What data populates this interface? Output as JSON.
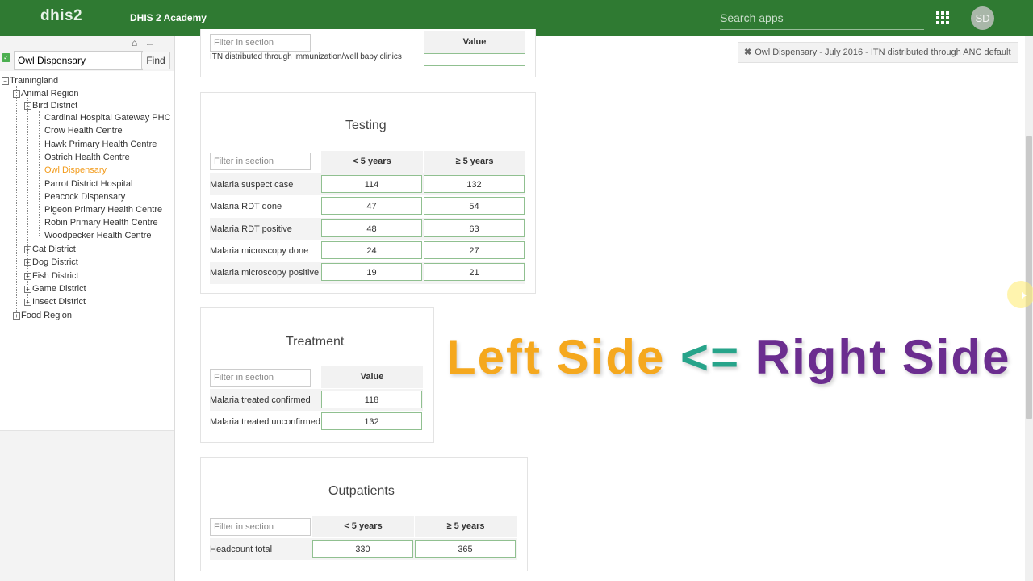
{
  "header": {
    "logo": "dhis2",
    "app_title": "DHIS 2 Academy",
    "search_placeholder": "Search apps",
    "avatar_initials": "SD"
  },
  "orgunit_panel": {
    "find_value": "Owl Dispensary",
    "find_label": "Find",
    "tree": {
      "root": "Trainingland",
      "region": "Animal Region",
      "district": "Bird District",
      "facilities": [
        "Cardinal Hospital Gateway PHC",
        "Crow Health Centre",
        "Hawk Primary Health Centre",
        "Ostrich Health Centre",
        "Owl Dispensary",
        "Parrot District Hospital",
        "Peacock Dispensary",
        "Pigeon Primary Health Centre",
        "Robin Primary Health Centre",
        "Woodpecker Health Centre"
      ],
      "selected": "Owl Dispensary",
      "other_districts": [
        "Cat District",
        "Dog District",
        "Fish District",
        "Game District",
        "Insect District"
      ],
      "other_region": "Food Region"
    }
  },
  "top_partial_section": {
    "filter_placeholder": "Filter in section",
    "value_header": "Value",
    "row_label": "ITN distributed through immunization/well baby clinics"
  },
  "history_tag": {
    "text": "Owl Dispensary - July 2016 - ITN distributed through ANC default"
  },
  "testing": {
    "title": "Testing",
    "filter_placeholder": "Filter in section",
    "columns": [
      "< 5 years",
      "≥ 5 years"
    ],
    "rows": [
      {
        "label": "Malaria suspect case",
        "values": [
          "114",
          "132"
        ]
      },
      {
        "label": "Malaria RDT done",
        "values": [
          "47",
          "54"
        ]
      },
      {
        "label": "Malaria RDT positive",
        "values": [
          "48",
          "63"
        ]
      },
      {
        "label": "Malaria microscopy done",
        "values": [
          "24",
          "27"
        ]
      },
      {
        "label": "Malaria microscopy positive",
        "values": [
          "19",
          "21"
        ]
      }
    ]
  },
  "treatment": {
    "title": "Treatment",
    "filter_placeholder": "Filter in section",
    "columns": [
      "Value"
    ],
    "rows": [
      {
        "label": "Malaria treated confirmed",
        "values": [
          "118"
        ]
      },
      {
        "label": "Malaria treated unconfirmed",
        "values": [
          "132"
        ]
      }
    ]
  },
  "outpatients": {
    "title": "Outpatients",
    "filter_placeholder": "Filter in section",
    "columns": [
      "< 5 years",
      "≥ 5 years"
    ],
    "rows": [
      {
        "label": "Headcount total",
        "values": [
          "330",
          "365"
        ]
      }
    ]
  },
  "overlay": {
    "left": "Left Side",
    "op": "<=",
    "right": "Right Side"
  },
  "colors": {
    "header_green": "#2f7a32",
    "selected_orange": "#f29b1b",
    "overlay_orange": "#f5a81e",
    "overlay_teal": "#27a48a",
    "overlay_purple": "#6b2d8f"
  }
}
